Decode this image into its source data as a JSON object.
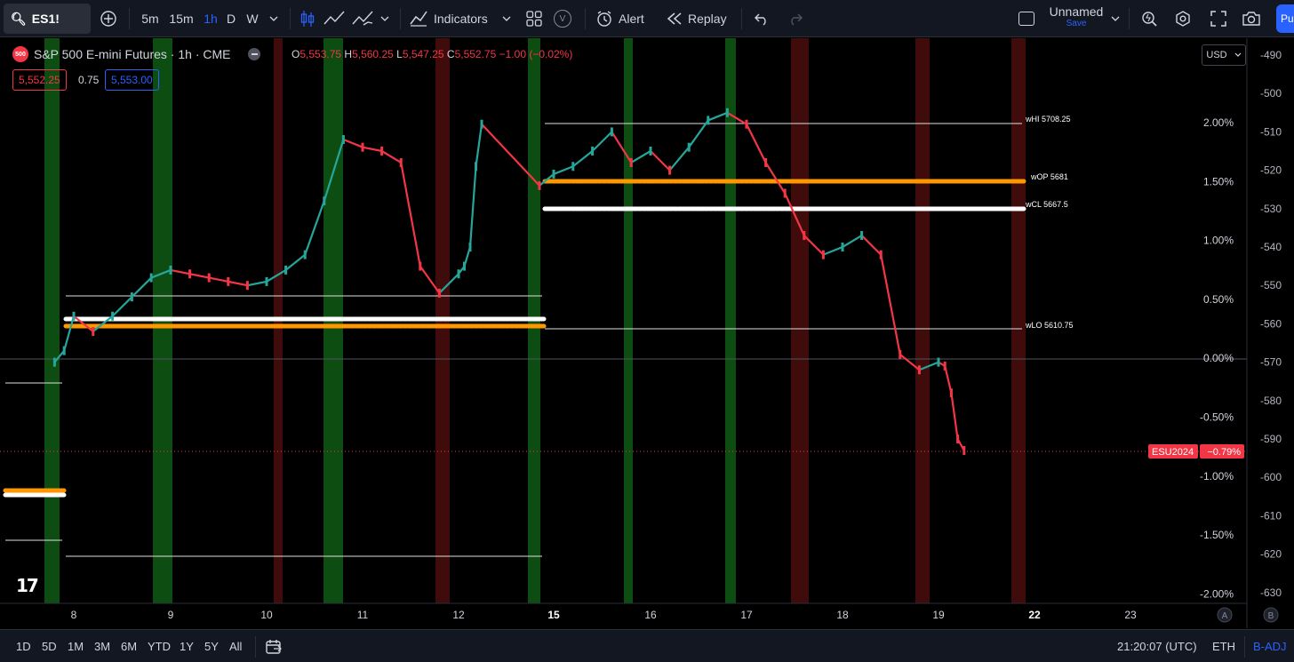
{
  "toolbar": {
    "symbol": "ES1!",
    "timeframes": [
      "5m",
      "15m",
      "1h",
      "D",
      "W"
    ],
    "active_timeframe": "1h",
    "indicators_label": "Indicators",
    "alert_label": "Alert",
    "replay_label": "Replay",
    "v_badge": "V",
    "layout_name": "Unnamed",
    "layout_save": "Save",
    "publish_label": "Pu"
  },
  "legend": {
    "badge": "500",
    "title": "S&P 500 E-mini Futures · 1h · CME",
    "ohlc": {
      "o_label": "O",
      "o": "5,553.75",
      "h_label": "H",
      "h": "5,560.25",
      "l_label": "L",
      "l": "5,547.25",
      "c_label": "C",
      "c": "5,552.75",
      "change": "−1.00 (−0.02%)"
    },
    "bid": "5,552.25",
    "spread": "0.75",
    "ask": "5,553.00"
  },
  "currency": "USD",
  "colors": {
    "up": "#26a69a",
    "down": "#f23645",
    "green_band": "#0f5a14",
    "red_band": "#4a0d0d",
    "orange": "#ff9800",
    "white": "#ffffff",
    "accent": "#2962ff"
  },
  "chart_data": {
    "type": "line",
    "title": "S&P 500 E-mini Futures · 1h · CME",
    "x_ticks": [
      "8",
      "9",
      "10",
      "11",
      "12",
      "15",
      "16",
      "17",
      "18",
      "19",
      "22",
      "23"
    ],
    "right_axis_ticks": [
      "-490",
      "-500",
      "-510",
      "-520",
      "-530",
      "-540",
      "-550",
      "-560",
      "-570",
      "-580",
      "-590",
      "-600",
      "-610",
      "-620",
      "-630"
    ],
    "percent_ticks": [
      "2.00%",
      "1.50%",
      "1.00%",
      "0.50%",
      "0.00%",
      "-0.50%",
      "-1.00%",
      "-1.50%",
      "-2.00%"
    ],
    "series": [
      {
        "x": [
          7.8,
          7.9,
          8.0,
          8.2,
          8.4,
          8.6,
          8.8,
          9.0,
          9.2,
          9.4,
          9.6,
          9.8,
          10.0,
          10.2,
          10.4,
          10.6,
          10.8,
          11.0,
          11.2,
          11.4,
          11.6,
          11.8,
          12.0,
          12.2,
          12.4,
          12.6,
          12.8,
          14.8,
          15.0,
          15.2,
          15.4,
          15.6,
          15.8,
          16.0,
          16.2,
          16.4,
          16.6,
          16.8,
          17.0,
          17.2,
          17.4,
          17.6,
          17.8,
          18.0,
          18.2,
          18.4,
          18.6,
          18.8,
          19.0,
          19.2,
          19.4,
          19.6,
          19.8
        ],
        "values": [
          -570,
          -567,
          -558,
          -562,
          -558,
          -553,
          -548,
          -546,
          -547,
          -548,
          -549,
          -550,
          -549,
          -546,
          -542,
          -528,
          -512,
          -514,
          -515,
          -518,
          -545,
          -552,
          -547,
          -545,
          -540,
          -519,
          -508,
          -524,
          -521,
          -519,
          -515,
          -510,
          -518,
          -515,
          -520,
          -514,
          -507,
          -505,
          -508,
          -518,
          -526,
          -537,
          -542,
          -540,
          -537,
          -542,
          -568,
          -572,
          -570,
          -571,
          -578,
          -590,
          -593
        ]
      }
    ],
    "levels": [
      {
        "label": "wHI 5708.25"
      },
      {
        "label": "wOP 5681"
      },
      {
        "label": "wCL 5667.5"
      },
      {
        "label": "wLO 5610.75"
      }
    ],
    "last_price_label": "ESU2024",
    "last_change_label": "−0.79%",
    "scale_buttons": [
      "A",
      "B"
    ]
  },
  "bottombar": {
    "ranges": [
      "1D",
      "5D",
      "1M",
      "3M",
      "6M",
      "YTD",
      "1Y",
      "5Y",
      "All"
    ],
    "time": "21:20:07 (UTC)",
    "session": "ETH",
    "adjustment": "B-ADJ"
  }
}
